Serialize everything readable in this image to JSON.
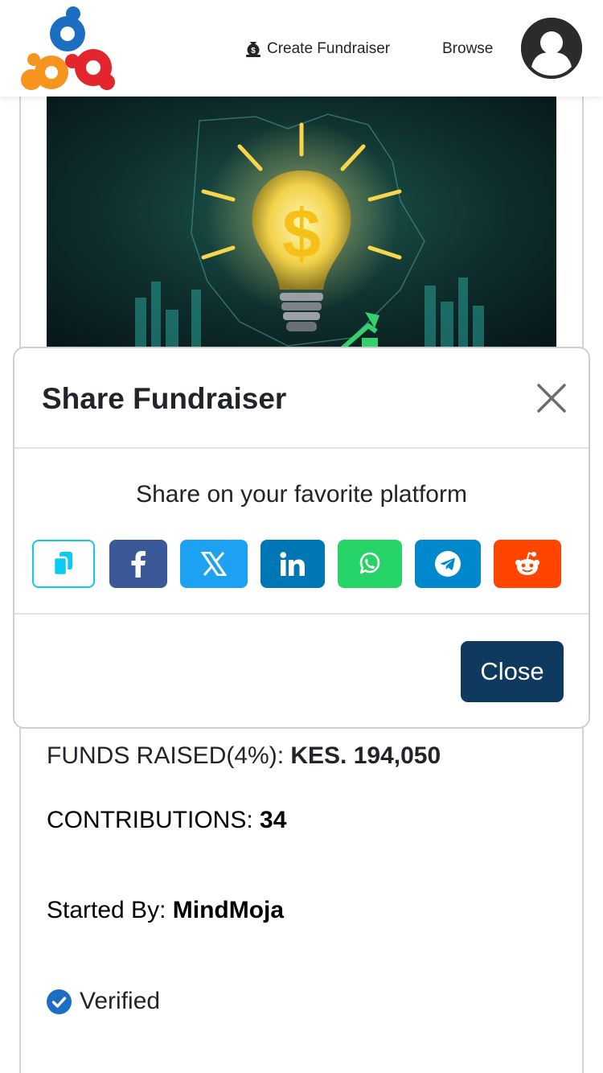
{
  "header": {
    "logo_icon": "community-logo-icon",
    "create_fundraiser_label": "Create Fundraiser",
    "create_fundraiser_icon": "money-bag-icon",
    "browse_label": "Browse",
    "avatar_icon": "user-avatar-icon"
  },
  "fundraiser": {
    "image_icon": "lightbulb-dollar-image",
    "funds_raised_label": "FUNDS RAISED(4%): ",
    "funds_raised_value": "KES. 194,050",
    "contributions_label": "CONTRIBUTIONS: ",
    "contributions_value": "34",
    "started_by_label": "Started By: ",
    "started_by_value": "MindMoja",
    "verified_label": "Verified",
    "verified_icon": "check-circle-icon"
  },
  "modal": {
    "title": "Share Fundraiser",
    "subtitle": "Share on your favorite platform",
    "close_label": "Close",
    "share_buttons": [
      {
        "name": "copy-link",
        "icon": "copy-icon",
        "color": "#0dcaf0"
      },
      {
        "name": "facebook",
        "icon": "facebook-icon",
        "color": "#3b5998"
      },
      {
        "name": "x",
        "icon": "x-icon",
        "color": "#1da1f2"
      },
      {
        "name": "linkedin",
        "icon": "linkedin-icon",
        "color": "#0077b5"
      },
      {
        "name": "whatsapp",
        "icon": "whatsapp-icon",
        "color": "#25d366"
      },
      {
        "name": "telegram",
        "icon": "telegram-icon",
        "color": "#0088cc"
      },
      {
        "name": "reddit",
        "icon": "reddit-icon",
        "color": "#ff4500"
      }
    ]
  },
  "colors": {
    "primary_dark": "#0e3a5f",
    "verified_blue": "#1b6ec2",
    "text": "#212529"
  }
}
